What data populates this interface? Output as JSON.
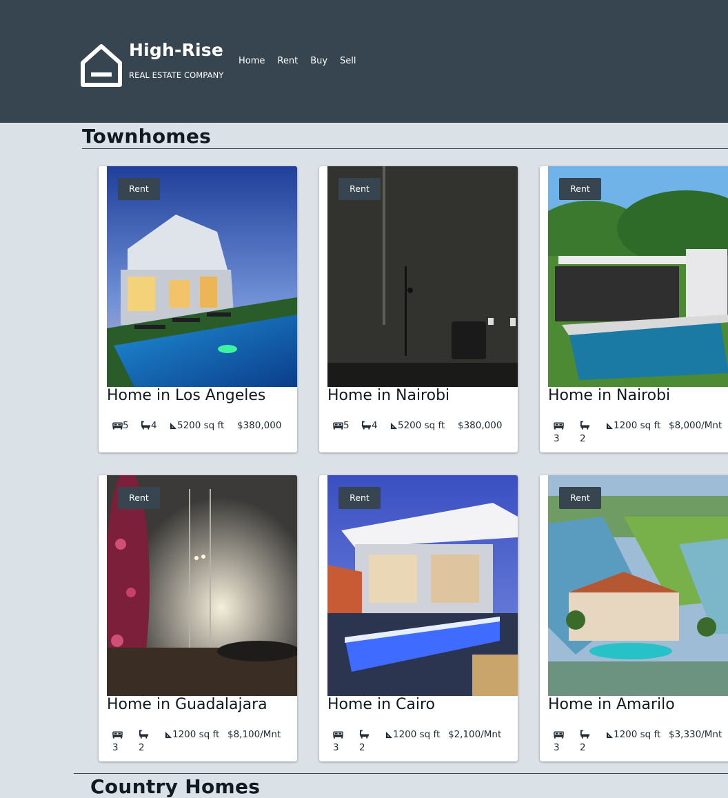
{
  "brand": {
    "name": "High-Rise",
    "tagline": "REAL ESTATE COMPANY",
    "icon": "home-outline-icon"
  },
  "nav": {
    "items": [
      "Home",
      "Rent",
      "Buy",
      "Sell"
    ]
  },
  "sections": {
    "townhomes": {
      "title": "Townhomes"
    },
    "country": {
      "title": "Country Homes"
    }
  },
  "listings": [
    {
      "badge": "Rent",
      "title": "Home in Los Angeles",
      "beds": "5",
      "baths": "4",
      "area": "5200 sq ft",
      "price": "$380,000"
    },
    {
      "badge": "Rent",
      "title": "Home in Nairobi",
      "beds": "5",
      "baths": "4",
      "area": "5200 sq ft",
      "price": "$380,000"
    },
    {
      "badge": "Rent",
      "title": "Home in Nairobi",
      "beds": "3",
      "baths": "2",
      "area": "1200 sq ft",
      "price": "$8,000/Mnt"
    },
    {
      "badge": "Rent",
      "title": "Home in Guadalajara",
      "beds": "3",
      "baths": "2",
      "area": "1200 sq ft",
      "price": "$8,100/Mnt"
    },
    {
      "badge": "Rent",
      "title": "Home in Cairo",
      "beds": "3",
      "baths": "2",
      "area": "1200 sq ft",
      "price": "$2,100/Mnt"
    },
    {
      "badge": "Rent",
      "title": "Home in Amarilo",
      "beds": "3",
      "baths": "2",
      "area": "1200 sq ft",
      "price": "$3,330/Mnt"
    }
  ],
  "colors": {
    "header": "#36454f",
    "background": "#dae1e7",
    "badge": "#36454f"
  }
}
